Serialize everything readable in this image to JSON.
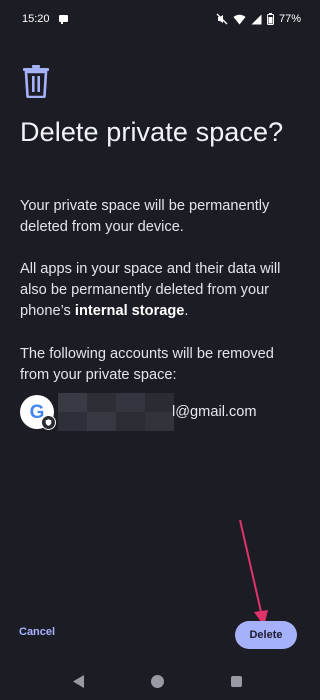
{
  "status_bar": {
    "time": "15:20",
    "battery": "77%",
    "icons": [
      "notification-icon",
      "mute-icon",
      "wifi-icon",
      "signal-icon",
      "battery-icon"
    ]
  },
  "dialog": {
    "icon": "trash-icon",
    "title": "Delete private space?",
    "paragraph1": "Your private space will be permanently deleted from your device.",
    "paragraph2_prefix": "All apps in your space and their data will also be permanently deleted from your phone’s ",
    "paragraph2_bold": "internal storage",
    "paragraph2_suffix": ".",
    "paragraph3": "The following accounts will be removed from your private space:",
    "account": {
      "avatar_letter": "G",
      "email_visible": "l@gmail.com"
    }
  },
  "actions": {
    "cancel_label": "Cancel",
    "delete_label": "Delete"
  },
  "colors": {
    "background": "#1c1c24",
    "accent": "#a6b1fb",
    "annotation_arrow": "#e0336a"
  },
  "nav_bar": {
    "icons": [
      "back-icon",
      "home-icon",
      "recents-icon"
    ]
  }
}
